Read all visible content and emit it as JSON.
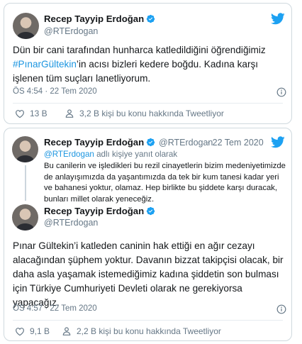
{
  "card1": {
    "author_name": "Recep Tayyip Erdoğan",
    "author_handle": "@RTErdogan",
    "text_part1": "Dün bir cani tarafından hunharca katledildiğini öğrendiğimiz",
    "hashtag": "#PınarGültekin",
    "text_part2": "’in acısı bizleri kedere boğdu. Kadına karşı işlenen tüm suçları lanetliyorum.",
    "timestamp": "ÖS 4:54 · 22 Tem 2020",
    "likes": "13 B",
    "people_talking": "3,2 B kişi bu konu hakkında Tweetliyor"
  },
  "card2": {
    "parent": {
      "author_name": "Recep Tayyip Erdoğan",
      "author_handle": "@RTErdogan",
      "date": "· 22 Tem 2020",
      "reply_to_prefix": "@RTErdogan",
      "reply_to_suffix": " adlı kişiye yanıt olarak",
      "text": "Bu canilerin ve işledikleri bu rezil cinayetlerin bizim medeniyetimizde de anlayışımızda da yaşantımızda da tek bir kum tanesi kadar yeri ve bahanesi yoktur, olamaz. Hep birlikte bu şiddete karşı duracak, bunları millet olarak yeneceğiz."
    },
    "main": {
      "author_name": "Recep Tayyip Erdoğan",
      "author_handle": "@RTErdogan",
      "text": "Pınar Gültekin’i katleden caninin hak ettiği en ağır cezayı alacağından şüphem yoktur. Davanın bizzat takipçisi olacak, bir daha asla yaşamak istemediğimiz kadına şiddetin son bulması için Türkiye Cumhuriyeti Devleti olarak ne gerekiyorsa yapacağız.",
      "timestamp": "ÖS 4:57 · 22 Tem 2020",
      "likes": "9,1 B",
      "people_talking": "2,2 B kişi bu konu hakkında Tweetliyor"
    }
  },
  "colors": {
    "twitter_blue": "#1da1f2",
    "link_blue": "#1b95e0",
    "secondary_text": "#657786",
    "border": "#cfd9de"
  },
  "icons": [
    "twitter-bird-icon",
    "verified-badge-icon",
    "info-icon",
    "heart-icon",
    "person-icon"
  ]
}
